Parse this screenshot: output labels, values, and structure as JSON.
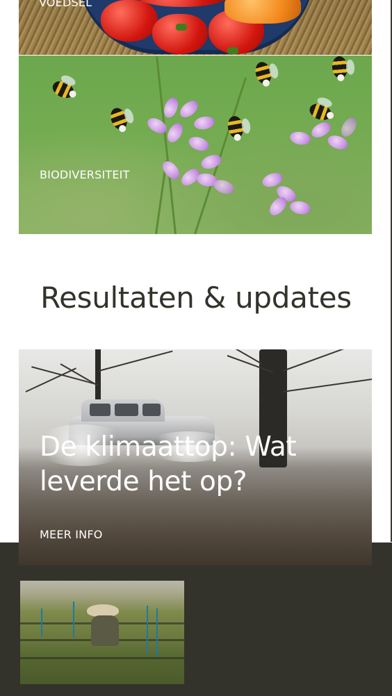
{
  "cards": {
    "food": {
      "label": "VOEDSEL"
    },
    "biodiversity": {
      "label": "BIODIVERSITEIT"
    }
  },
  "results": {
    "title": "Resultaten & updates",
    "featured": {
      "headline": "De klimaattop: Wat leverde het op?",
      "cta": "MEER INFO"
    }
  }
}
